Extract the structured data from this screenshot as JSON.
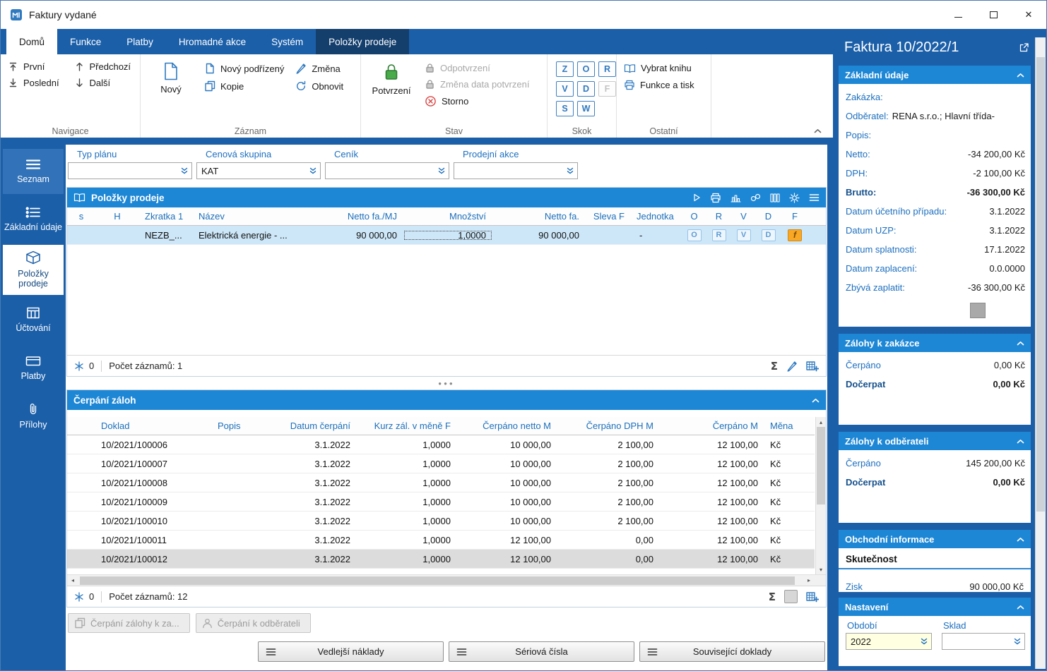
{
  "window": {
    "title": "Faktury vydané"
  },
  "ribbon": {
    "tabs": [
      {
        "label": "Domů",
        "state": "active"
      },
      {
        "label": "Funkce",
        "state": "normal"
      },
      {
        "label": "Platby",
        "state": "normal"
      },
      {
        "label": "Hromadné akce",
        "state": "normal"
      },
      {
        "label": "Systém",
        "state": "normal"
      },
      {
        "label": "Položky prodeje",
        "state": "context"
      }
    ],
    "navigace": {
      "label": "Navigace",
      "prvni": "První",
      "posledni": "Poslední",
      "predchozi": "Předchozí",
      "dalsi": "Další"
    },
    "zaznam": {
      "label": "Záznam",
      "novy": "Nový",
      "novy_podrizeny": "Nový podřízený",
      "kopie": "Kopie",
      "zmena": "Změna",
      "obnovit": "Obnovit"
    },
    "stav": {
      "label": "Stav",
      "potvrzeni": "Potvrzení",
      "odpotvrzeni": "Odpotvrzení",
      "zmena_data": "Změna data potvrzení",
      "storno": "Storno"
    },
    "skok": {
      "label": "Skok",
      "keys": [
        {
          "k": "Z",
          "enabled": true
        },
        {
          "k": "O",
          "enabled": true
        },
        {
          "k": "R",
          "enabled": true
        },
        {
          "k": "V",
          "enabled": true
        },
        {
          "k": "D",
          "enabled": true
        },
        {
          "k": "F",
          "enabled": false
        },
        {
          "k": "S",
          "enabled": true
        },
        {
          "k": "W",
          "enabled": true
        }
      ]
    },
    "ostatni": {
      "label": "Ostatní",
      "vybrat_knihu": "Vybrat knihu",
      "funkce_a_tisk": "Funkce a tisk"
    }
  },
  "sidebar": [
    {
      "label": "Seznam",
      "icon": "listic",
      "state": "highlight"
    },
    {
      "label": "Základní údaje",
      "icon": "form",
      "state": "normal"
    },
    {
      "label": "Položky prodeje",
      "icon": "box",
      "state": "active"
    },
    {
      "label": "Účtování",
      "icon": "calc",
      "state": "normal"
    },
    {
      "label": "Platby",
      "icon": "card",
      "state": "normal"
    },
    {
      "label": "Přílohy",
      "icon": "clip",
      "state": "normal"
    }
  ],
  "filters": [
    {
      "label": "Typ plánu",
      "value": ""
    },
    {
      "label": "Cenová skupina",
      "value": "KAT"
    },
    {
      "label": "Ceník",
      "value": ""
    },
    {
      "label": "Prodejní akce",
      "value": ""
    }
  ],
  "polozky": {
    "title": "Položky prodeje",
    "columns": [
      "s",
      "H",
      "Zkratka 1",
      "Název",
      "Netto fa./MJ",
      "Množství",
      "Netto fa.",
      "Sleva F",
      "Jednotka",
      "O",
      "R",
      "V",
      "D",
      "F"
    ],
    "row": {
      "zkratka": "NEZB_...",
      "nazev": "Elektrická energie - ...",
      "netto_mj": "90 000,00",
      "mnozstvi": "1,0000",
      "netto": "90 000,00",
      "sleva": "",
      "jednotka": "-",
      "o": "O",
      "r": "R",
      "v": "V",
      "d": "D",
      "f": "f"
    },
    "footer": {
      "flag": "0",
      "count": "Počet záznamů: 1"
    }
  },
  "cerpani": {
    "title": "Čerpání záloh",
    "columns": [
      "Doklad",
      "Popis",
      "Datum čerpání",
      "Kurz zál. v měně F",
      "Čerpáno netto M",
      "Čerpáno DPH M",
      "Čerpáno M",
      "Měna"
    ],
    "rows": [
      {
        "doklad": "10/2021/100006",
        "popis": "",
        "datum": "3.1.2022",
        "kurz": "1,0000",
        "netto": "10 000,00",
        "dph": "2 100,00",
        "celkem": "12 100,00",
        "mena": "Kč",
        "selected": false
      },
      {
        "doklad": "10/2021/100007",
        "popis": "",
        "datum": "3.1.2022",
        "kurz": "1,0000",
        "netto": "10 000,00",
        "dph": "2 100,00",
        "celkem": "12 100,00",
        "mena": "Kč",
        "selected": false
      },
      {
        "doklad": "10/2021/100008",
        "popis": "",
        "datum": "3.1.2022",
        "kurz": "1,0000",
        "netto": "10 000,00",
        "dph": "2 100,00",
        "celkem": "12 100,00",
        "mena": "Kč",
        "selected": false
      },
      {
        "doklad": "10/2021/100009",
        "popis": "",
        "datum": "3.1.2022",
        "kurz": "1,0000",
        "netto": "10 000,00",
        "dph": "2 100,00",
        "celkem": "12 100,00",
        "mena": "Kč",
        "selected": false
      },
      {
        "doklad": "10/2021/100010",
        "popis": "",
        "datum": "3.1.2022",
        "kurz": "1,0000",
        "netto": "10 000,00",
        "dph": "2 100,00",
        "celkem": "12 100,00",
        "mena": "Kč",
        "selected": false
      },
      {
        "doklad": "10/2021/100011",
        "popis": "",
        "datum": "3.1.2022",
        "kurz": "1,0000",
        "netto": "12 100,00",
        "dph": "0,00",
        "celkem": "12 100,00",
        "mena": "Kč",
        "selected": false
      },
      {
        "doklad": "10/2021/100012",
        "popis": "",
        "datum": "3.1.2022",
        "kurz": "1,0000",
        "netto": "12 100,00",
        "dph": "0,00",
        "celkem": "12 100,00",
        "mena": "Kč",
        "selected": true
      }
    ],
    "footer": {
      "flag": "0",
      "count": "Počet záznamů: 12"
    },
    "actions": [
      {
        "label": "Čerpání zálohy k za...",
        "icon": "copy"
      },
      {
        "label": "Čerpání k odběrateli",
        "icon": "person"
      }
    ]
  },
  "bottom_buttons": [
    {
      "label": "Vedlejší náklady"
    },
    {
      "label": "Sériová čísla"
    },
    {
      "label": "Související doklady"
    }
  ],
  "detail": {
    "title": "Faktura 10/2022/1",
    "zakladni": {
      "title": "Základní údaje",
      "rows": [
        {
          "label": "Zakázka:",
          "value": "",
          "bold": false
        },
        {
          "label": "Odběratel:",
          "value": "RENA s.r.o.; Hlavní třída-",
          "align": "left",
          "bold": false
        },
        {
          "label": "Popis:",
          "value": "",
          "bold": false
        },
        {
          "label": "Netto:",
          "value": "-34 200,00 Kč",
          "bold": false
        },
        {
          "label": "DPH:",
          "value": "-2 100,00 Kč",
          "bold": false
        },
        {
          "label": "Brutto:",
          "value": "-36 300,00 Kč",
          "bold": true
        },
        {
          "label": "Datum účetního případu:",
          "value": "3.1.2022",
          "bold": false
        },
        {
          "label": "Datum UZP:",
          "value": "3.1.2022",
          "bold": false
        },
        {
          "label": "Datum splatnosti:",
          "value": "17.1.2022",
          "bold": false
        },
        {
          "label": "Datum zaplacení:",
          "value": "0.0.0000",
          "bold": false
        },
        {
          "label": "Zbývá zaplatit:",
          "value": "-36 300,00 Kč",
          "bold": false
        }
      ]
    },
    "zalohy_zakazce": {
      "title": "Zálohy k zakázce",
      "rows": [
        {
          "label": "Čerpáno",
          "value": "0,00 Kč",
          "bold": false
        },
        {
          "label": "Dočerpat",
          "value": "0,00 Kč",
          "bold": true
        }
      ]
    },
    "zalohy_odberateli": {
      "title": "Zálohy k odběrateli",
      "rows": [
        {
          "label": "Čerpáno",
          "value": "145 200,00 Kč",
          "bold": false
        },
        {
          "label": "Dočerpat",
          "value": "0,00 Kč",
          "bold": true
        }
      ]
    },
    "obchodni": {
      "title": "Obchodní informace",
      "tab": "Skutečnost",
      "partial": {
        "label": "Zisk",
        "value": "90 000,00 Kč"
      }
    },
    "nastaveni": {
      "title": "Nastavení",
      "obdobi_label": "Období",
      "obdobi_value": "2022",
      "sklad_label": "Sklad",
      "sklad_value": ""
    }
  },
  "colors": {
    "accent_blue": "#1b5fa9",
    "panel_header_blue": "#1e87d5",
    "selected_row": "#cde7f8",
    "badge_orange": "#f9a825",
    "label_blue": "#1c6fbf"
  }
}
